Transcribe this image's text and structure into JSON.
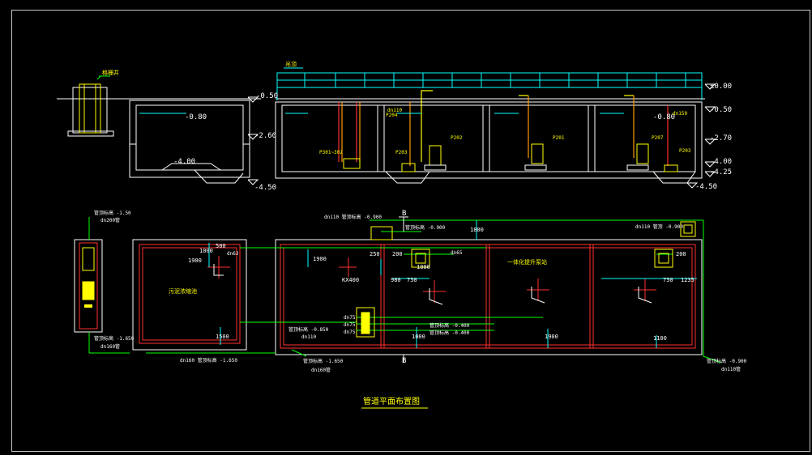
{
  "drawing": {
    "title": "管道平面布置图",
    "section_marks": [
      "B",
      "B"
    ],
    "colors": {
      "background": "#000000",
      "frame": "#c8c8c8",
      "wall": "#ffffff",
      "dim": "#00ffff",
      "pipe": "#00ff00",
      "red_pipe": "#ff3030",
      "orange_pipe": "#ff9900",
      "yellow": "#ffff00",
      "magenta": "#ff00ff"
    }
  },
  "section": {
    "top_label": "吊顶",
    "elevations_left": [
      "-0.50",
      "-0.80",
      "-2.60",
      "-4.00",
      "-4.50"
    ],
    "elevations_right": [
      "±0.00",
      "-0.50",
      "-0.80",
      "-2.70",
      "-4.00",
      "-4.25",
      "-4.50"
    ],
    "pump_labels": [
      "P301~302",
      "P203",
      "P202",
      "P201",
      "P204",
      "P207",
      "P203"
    ],
    "pipe_labels": [
      "dn110",
      "dn150"
    ],
    "inlet_label": "格栅井"
  },
  "plan": {
    "left_basin_label": "污泥浓缩池",
    "right_label": "一体化提升泵站",
    "dims": [
      "1000",
      "1900",
      "1900",
      "500",
      "1500",
      "980",
      "750",
      "250",
      "200",
      "750",
      "1235",
      "1000",
      "1900",
      "1100",
      "1000",
      "200",
      "1800",
      "KX400"
    ],
    "pipe_texts": [
      "dn110 管顶标高 -0.900",
      "管顶标高 -0.900",
      "dn110 管顶 -0.900",
      "dn63",
      "dn65",
      "dn110",
      "dn75",
      "dn75",
      "dn75",
      "管顶标高 -0.850",
      "管顶标高 -0.400",
      "管顶标高 -0.400",
      "dn160 管顶标高 -1.650",
      "管顶标高 -1.650",
      "dn160管",
      "管顶标高 -0.900",
      "dn110管",
      "管顶标高 -1.50",
      "dn200管",
      "管顶标高 -1.650",
      "dn160管"
    ]
  }
}
